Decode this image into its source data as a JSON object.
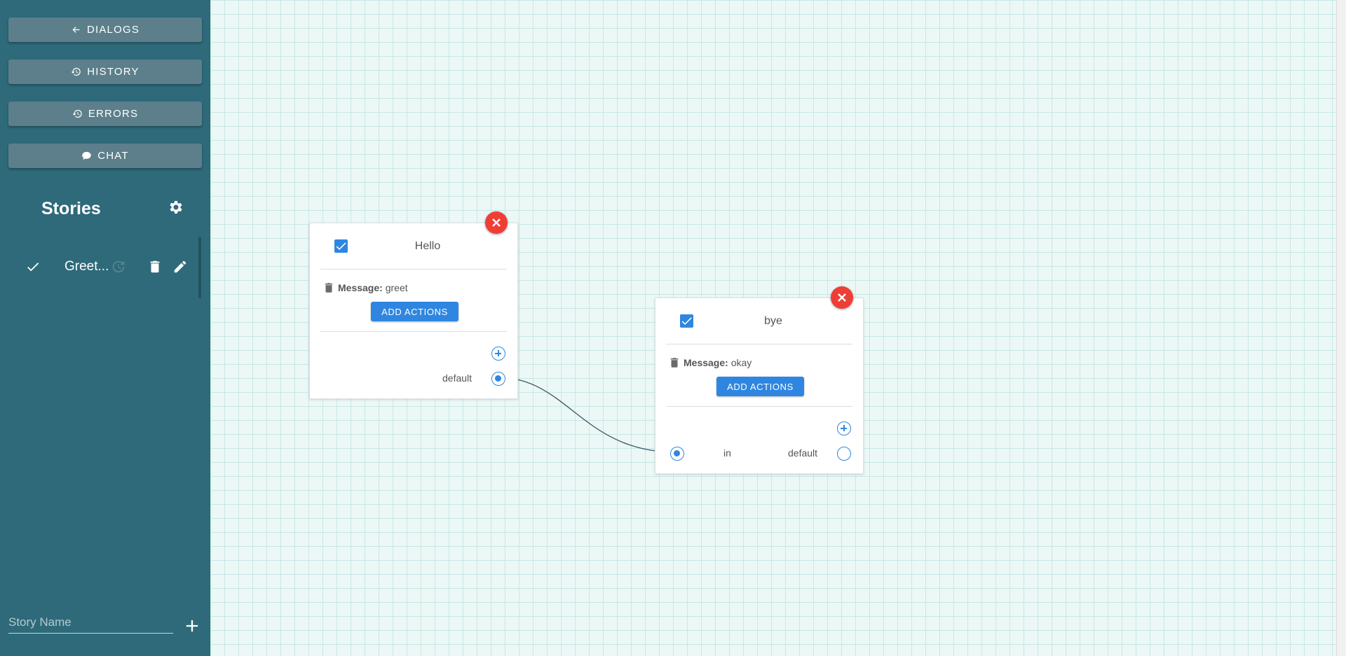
{
  "sidebar": {
    "nav": [
      {
        "label": "DIALOGS",
        "icon": "back-arrow-icon"
      },
      {
        "label": "HISTORY",
        "icon": "history-icon"
      },
      {
        "label": "ERRORS",
        "icon": "history-icon"
      },
      {
        "label": "CHAT",
        "icon": "chat-bubble-icon"
      }
    ],
    "stories_title": "Stories",
    "stories": [
      {
        "name": "Greet..."
      }
    ],
    "new_story_placeholder": "Story Name"
  },
  "canvas": {
    "nodes": [
      {
        "title": "Hello",
        "checked": true,
        "message_label": "Message:",
        "message_value": "greet",
        "add_actions_label": "ADD ACTIONS",
        "out_port_label": "default"
      },
      {
        "title": "bye",
        "checked": true,
        "message_label": "Message:",
        "message_value": "okay",
        "add_actions_label": "ADD ACTIONS",
        "in_port_label": "in",
        "out_port_label": "default"
      }
    ]
  },
  "colors": {
    "sidebar": "#2e6a7a",
    "nav_button": "#5c7f8b",
    "accent": "#2f86e0",
    "close": "#ef3e36",
    "canvas_bg": "#ecf8f6"
  }
}
